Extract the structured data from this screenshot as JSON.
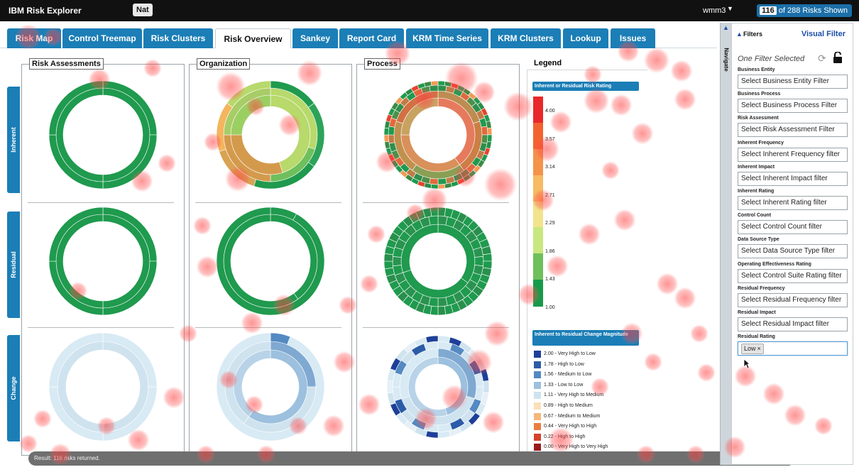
{
  "app": {
    "title": "IBM Risk Explorer",
    "user": "Nat",
    "workspace": "wmm3",
    "shown_count": "116",
    "shown_suffix": "of 288 Risks Shown"
  },
  "tabs": [
    {
      "label": "Risk Map"
    },
    {
      "label": "Control Treemap"
    },
    {
      "label": "Risk Clusters"
    },
    {
      "label": "Risk Overview",
      "active": true
    },
    {
      "label": "Sankey"
    },
    {
      "label": "Report Card"
    },
    {
      "label": "KRM Time Series"
    },
    {
      "label": "KRM Clusters"
    },
    {
      "label": "Lookup"
    },
    {
      "label": "Issues"
    }
  ],
  "rows": [
    "Inherent",
    "Residual",
    "Change"
  ],
  "panels": [
    "Risk Assessments",
    "Organization",
    "Process"
  ],
  "legend": {
    "title": "Legend",
    "rating_header": "Inherent or Residual Risk Rating",
    "rating_scale": [
      "4.00",
      "3.57",
      "3.14",
      "2.71",
      "2.29",
      "1.86",
      "1.43",
      "1.00"
    ],
    "rating_colors": [
      "#e8282a",
      "#f2622e",
      "#f4934a",
      "#f6bb63",
      "#f2e38c",
      "#c9e77f",
      "#6fbf5c",
      "#179a4a"
    ],
    "change_header": "Inherent to Residual Change Magnitude",
    "change_items": [
      {
        "label": "2.00 - Very High to Low",
        "color": "#1e3f99"
      },
      {
        "label": "1.78 - High to Low",
        "color": "#2c5ca8"
      },
      {
        "label": "1.56 - Medium to Low",
        "color": "#5489c2"
      },
      {
        "label": "1.33 - Low to Low",
        "color": "#9cc0de"
      },
      {
        "label": "1.11 - Very High to Medium",
        "color": "#cfe3ef"
      },
      {
        "label": "0.89 - High to Medium",
        "color": "#fbe0b8"
      },
      {
        "label": "0.67 - Medium to Medium",
        "color": "#f5b77c"
      },
      {
        "label": "0.44 - Very High to High",
        "color": "#ec7d3f"
      },
      {
        "label": "0.22 - High to High",
        "color": "#d6422a"
      },
      {
        "label": "0.00 - Very High to Very High",
        "color": "#9c1a1a"
      }
    ]
  },
  "status": "Result: 116 risks returned.",
  "navigate": "Navigate",
  "filters": {
    "header": "Filters",
    "visual_label": "Visual Filter",
    "selected_text": "One Filter Selected",
    "items": [
      {
        "label": "Business Entity",
        "value": "Select Business Entity Filter"
      },
      {
        "label": "Business Process",
        "value": "Select Business Process Filter"
      },
      {
        "label": "Risk Assessment",
        "value": "Select Risk Assessment Filter"
      },
      {
        "label": "Inherent Frequency",
        "value": "Select Inherent Frequency filter"
      },
      {
        "label": "Inherent Impact",
        "value": "Select Inherent Impact filter"
      },
      {
        "label": "Inherent Rating",
        "value": "Select Inherent Rating filter"
      },
      {
        "label": "Control Count",
        "value": "Select Control Count filter"
      },
      {
        "label": "Data Source Type",
        "value": "Select Data Source Type filter"
      },
      {
        "label": "Operating Effectiveness Rating",
        "value": "Select Control Suite Rating filter"
      },
      {
        "label": "Residual Frequency",
        "value": "Select Residual Frequency filter"
      },
      {
        "label": "Residual Impact",
        "value": "Select Residual Impact filter"
      },
      {
        "label": "Residual Rating",
        "chip": "Low"
      }
    ]
  }
}
